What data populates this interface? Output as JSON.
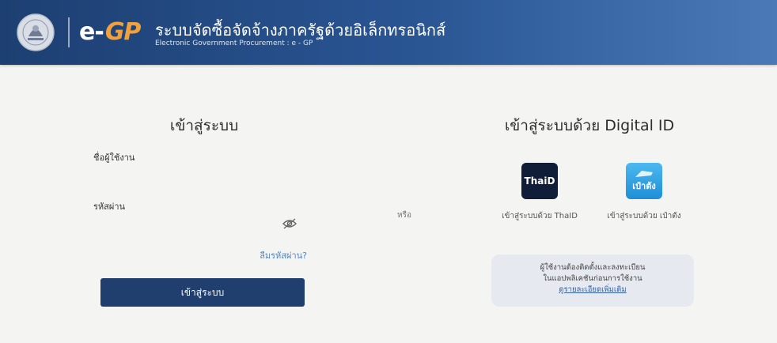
{
  "header": {
    "logo_e": "e-",
    "logo_gp": "GP",
    "title": "ระบบจัดซื้อจัดจ้างภาครัฐด้วยอิเล็กทรอนิกส์",
    "subtitle": "Electronic Government Procurement : e - GP"
  },
  "login": {
    "title": "เข้าสู่ระบบ",
    "username_label": "ชื่อผู้ใช้งาน",
    "username_value": "",
    "password_label": "รหัสผ่าน",
    "password_value": "",
    "forgot_label": "ลืมรหัสผ่าน?",
    "submit_label": "เข้าสู่ระบบ"
  },
  "or_label": "หรือ",
  "digital_id": {
    "title": "เข้าสู่ระบบด้วย Digital ID",
    "providers": [
      {
        "tile_text": "ThaiD",
        "label": "เข้าสู่ระบบด้วย ThaID"
      },
      {
        "tile_text": "เป๋าตัง",
        "label": "เข้าสู่ระบบด้วย เป๋าตัง"
      }
    ],
    "notice_line1": "ผู้ใช้งานต้องติดตั้งและลงทะเบียน",
    "notice_line2": "ในแอปพลิเคชันก่อนการใช้งาน",
    "notice_link": "ดูรายละเอียดเพิ่มเติม"
  },
  "colors": {
    "header": "#2a5694",
    "button": "#213f6e",
    "link": "#4f86c6",
    "accent": "#f2a03c"
  }
}
